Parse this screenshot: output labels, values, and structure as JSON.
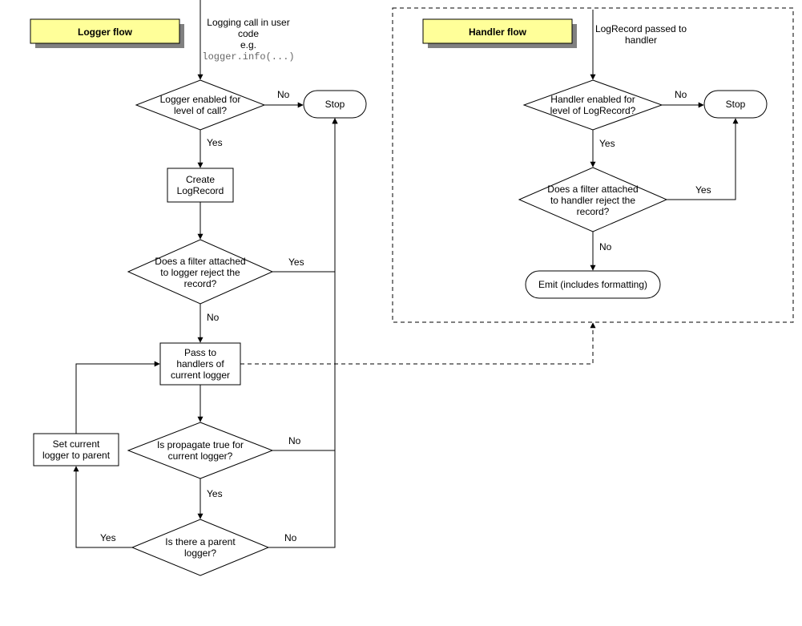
{
  "titles": {
    "logger": "Logger flow",
    "handler": "Handler flow"
  },
  "logger": {
    "start_l1": "Logging call in user",
    "start_l2": "code",
    "start_l3": "e.g.",
    "start_l4": "logger.info(...)",
    "d1_l1": "Logger enabled for",
    "d1_l2": "level of call?",
    "stop": "Stop",
    "p1_l1": "Create",
    "p1_l2": "LogRecord",
    "d2_l1": "Does a filter attached",
    "d2_l2": "to logger reject the",
    "d2_l3": "record?",
    "p2_l1": "Pass to",
    "p2_l2": "handlers of",
    "p2_l3": "current logger",
    "d3_l1": "Is propagate true for",
    "d3_l2": "current logger?",
    "d4_l1": "Is there a parent",
    "d4_l2": "logger?",
    "p3_l1": "Set current",
    "p3_l2": "logger to parent"
  },
  "handler": {
    "start_l1": "LogRecord passed to",
    "start_l2": "handler",
    "d1_l1": "Handler enabled for",
    "d1_l2": "level of LogRecord?",
    "stop": "Stop",
    "d2_l1": "Does a filter attached",
    "d2_l2": "to handler reject the",
    "d2_l3": "record?",
    "emit": "Emit (includes formatting)"
  },
  "labels": {
    "yes": "Yes",
    "no": "No"
  }
}
